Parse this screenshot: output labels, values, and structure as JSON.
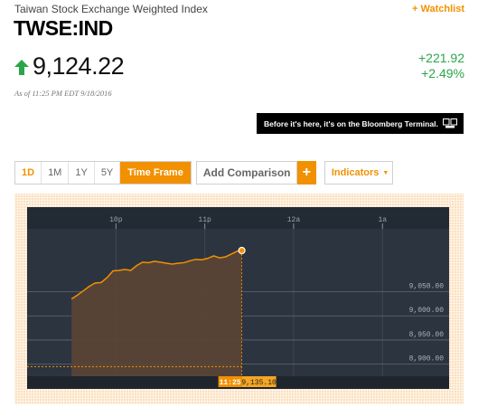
{
  "header": {
    "index_name": "Taiwan Stock Exchange Weighted Index",
    "watchlist_label": "+ Watchlist",
    "ticker": "TWSE:IND"
  },
  "quote": {
    "price": "9,124.22",
    "direction_icon": "arrow-up-icon",
    "change_abs": "+221.92",
    "change_pct": "+2.49%",
    "as_of": "As of 11:25 PM EDT 9/18/2016",
    "up_color": "#2aa54a"
  },
  "promo": {
    "text": "Before it's here, it's on the Bloomberg Terminal.",
    "icon": "terminal-icon"
  },
  "toolbar": {
    "timeframes": [
      "1D",
      "1M",
      "1Y",
      "5Y"
    ],
    "active_timeframe": "1D",
    "timeframe_label": "Time Frame",
    "add_comparison_label": "Add Comparison",
    "add_icon": "+",
    "indicators_label": "Indicators",
    "accent_color": "#f29100"
  },
  "chart_data": {
    "type": "area",
    "x_ticks": [
      "10p",
      "11p",
      "12a",
      "1a"
    ],
    "y_ticks": [
      "9,050.00",
      "9,000.00",
      "8,950.00",
      "8,900.00"
    ],
    "ylim": [
      8875,
      9225
    ],
    "x": [
      "21:30",
      "21:34",
      "21:38",
      "21:42",
      "21:46",
      "21:50",
      "21:54",
      "21:58",
      "22:02",
      "22:06",
      "22:10",
      "22:14",
      "22:18",
      "22:22",
      "22:26",
      "22:30",
      "22:34",
      "22:38",
      "22:42",
      "22:46",
      "22:50",
      "22:54",
      "22:58",
      "23:02",
      "23:06",
      "23:10",
      "23:14",
      "23:18",
      "23:22",
      "23:25"
    ],
    "values": [
      9035,
      9043,
      9052,
      9061,
      9068,
      9069,
      9079,
      9093,
      9094,
      9096,
      9094,
      9104,
      9111,
      9110,
      9113,
      9111,
      9109,
      9107,
      9109,
      9110,
      9114,
      9117,
      9116,
      9119,
      9124,
      9120,
      9122,
      9128,
      9134,
      9135.1
    ],
    "cursor": {
      "time": "11:25",
      "value": "9,135.10"
    },
    "dashed_reference": 8895,
    "background_color": "#2c3440",
    "line_color": "#f29100"
  }
}
